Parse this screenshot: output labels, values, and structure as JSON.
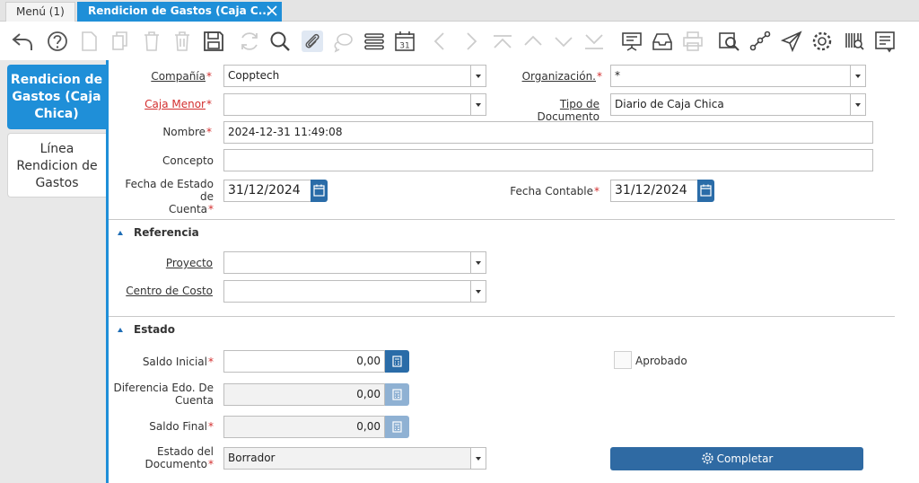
{
  "tabs": {
    "menu_label": "Menú (1)",
    "active_label": "Rendicion de Gastos (Caja C..."
  },
  "toolbar": {
    "icons": [
      "undo-icon",
      "help-icon",
      "new-record-icon",
      "copy-record-icon",
      "delete-icon",
      "delete-selection-icon",
      "save-icon",
      "refresh-icon",
      "find-icon",
      "attachment-icon",
      "chat-icon",
      "grid-toggle-icon",
      "calendar-icon",
      "first-record-icon",
      "previous-record-icon",
      "next-record-icon",
      "last-record-icon",
      "parent-icon",
      "detail-icon",
      "report-icon",
      "archive-icon",
      "print-icon",
      "zoom-across-icon",
      "workflow-icon",
      "request-icon",
      "settings-icon",
      "product-info-icon",
      "process-icon"
    ],
    "calendar_day": "31"
  },
  "left_tabs": {
    "active": "Rendicion de Gastos (Caja Chica)",
    "idle": "Línea Rendicion de Gastos"
  },
  "form": {
    "compania": {
      "label": "Compañía",
      "value": "Copptech"
    },
    "organizacion": {
      "label": "Organización.",
      "value": "*"
    },
    "caja_menor": {
      "label": "Caja Menor",
      "value": ""
    },
    "tipo_documento": {
      "label": "Tipo de Documento",
      "value": "Diario de Caja Chica"
    },
    "nombre": {
      "label": "Nombre",
      "value": "2024-12-31 11:49:08"
    },
    "concepto": {
      "label": "Concepto",
      "value": ""
    },
    "fecha_estado_cuenta": {
      "label_line1": "Fecha de Estado de",
      "label_line2": "Cuenta",
      "value": "31/12/2024"
    },
    "fecha_contable": {
      "label": "Fecha Contable",
      "value": "31/12/2024"
    }
  },
  "referencia": {
    "title": "Referencia",
    "proyecto": {
      "label": "Proyecto",
      "value": ""
    },
    "centro_costo": {
      "label": "Centro de Costo",
      "value": ""
    }
  },
  "estado": {
    "title": "Estado",
    "saldo_inicial": {
      "label": "Saldo Inicial",
      "value": "0,00"
    },
    "diferencia": {
      "label_line1": "Diferencia Edo. De",
      "label_line2": "Cuenta",
      "value": "0,00"
    },
    "saldo_final": {
      "label": "Saldo Final",
      "value": "0,00"
    },
    "aprobado": {
      "label": "Aprobado",
      "checked": false
    },
    "estado_documento": {
      "label_line1": "Estado del",
      "label_line2": "Documento",
      "value": "Borrador"
    },
    "completar_label": "Completar"
  },
  "required_marker": "*",
  "colors": {
    "accent": "#1f8fd8",
    "button": "#2f6aa3",
    "required": "#d32f2f"
  }
}
